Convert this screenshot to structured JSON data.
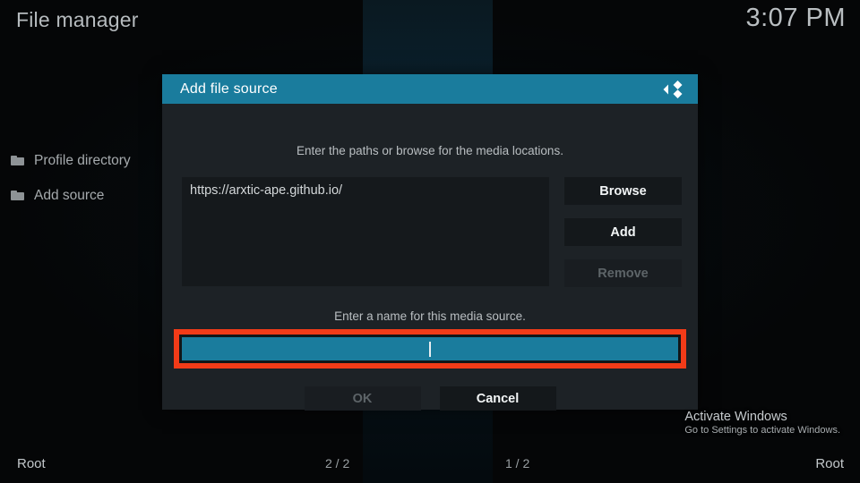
{
  "header": {
    "title": "File manager",
    "clock": "3:07 PM"
  },
  "file_list": {
    "items": [
      {
        "label": "Profile directory",
        "icon": "folder-icon"
      },
      {
        "label": "Add source",
        "icon": "folder-icon"
      }
    ]
  },
  "dialog": {
    "title": "Add file source",
    "logo_icon": "kodi-logo-icon",
    "hint_paths": "Enter the paths or browse for the media locations.",
    "hint_name": "Enter a name for this media source.",
    "paths": [
      "https://arxtic-ape.github.io/"
    ],
    "side_buttons": [
      {
        "label": "Browse",
        "disabled": false
      },
      {
        "label": "Add",
        "disabled": false
      },
      {
        "label": "Remove",
        "disabled": true
      }
    ],
    "name_field": {
      "value": "",
      "focused": true,
      "highlighted": true,
      "highlight_color": "#f23b18",
      "field_color": "#1a7c9d"
    },
    "bottom_buttons": [
      {
        "label": "OK",
        "disabled": true
      },
      {
        "label": "Cancel",
        "disabled": false
      }
    ]
  },
  "watermark": {
    "title": "Activate Windows",
    "subtitle": "Go to Settings to activate Windows."
  },
  "statusbar": {
    "left_root": "Root",
    "left_count": "2 / 2",
    "right_count": "1 / 2",
    "right_root": "Root"
  },
  "colors": {
    "accent_teal": "#1a7c9d",
    "dialog_bg": "#1d2226",
    "highlight_red": "#f23b18",
    "page_bg": "#050607"
  }
}
